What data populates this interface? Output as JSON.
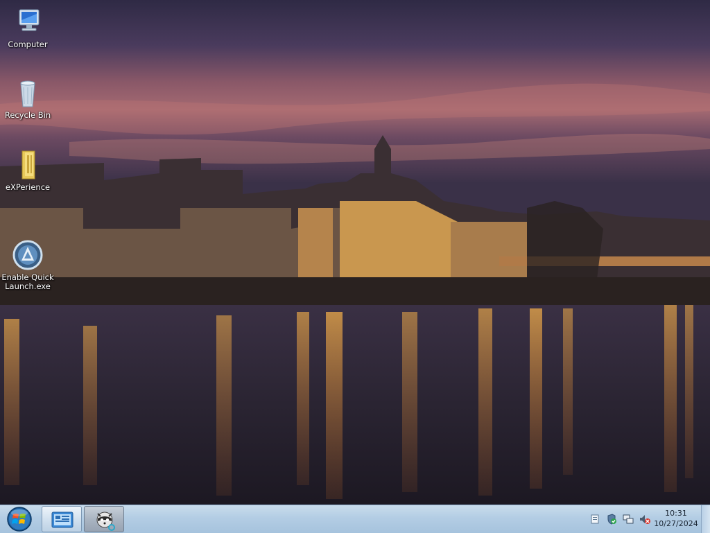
{
  "desktop": {
    "icons": [
      {
        "label": "Computer",
        "icon": "computer-icon"
      },
      {
        "label": "Recycle Bin",
        "icon": "recycle-bin-icon"
      },
      {
        "label": "eXPerience",
        "icon": "folder-icon"
      },
      {
        "label": "Enable Quick\nLaunch.exe",
        "icon": "app-icon"
      }
    ]
  },
  "taskbar": {
    "start": {
      "icon": "windows-orb-icon"
    },
    "buttons": [
      {
        "icon": "control-panel-icon"
      },
      {
        "icon": "raccoon-app-icon"
      }
    ],
    "tray": {
      "icons": [
        "action-center-icon",
        "security-shield-icon",
        "network-icon",
        "volume-muted-icon"
      ],
      "time": "10:31",
      "date": "10/27/2024"
    }
  },
  "colors": {
    "taskbar": "#b3cde4",
    "sky_top": "#2f2a45",
    "sky_glow": "#9a5a6a",
    "water": "#1a1721",
    "lights": "#f2a341"
  }
}
